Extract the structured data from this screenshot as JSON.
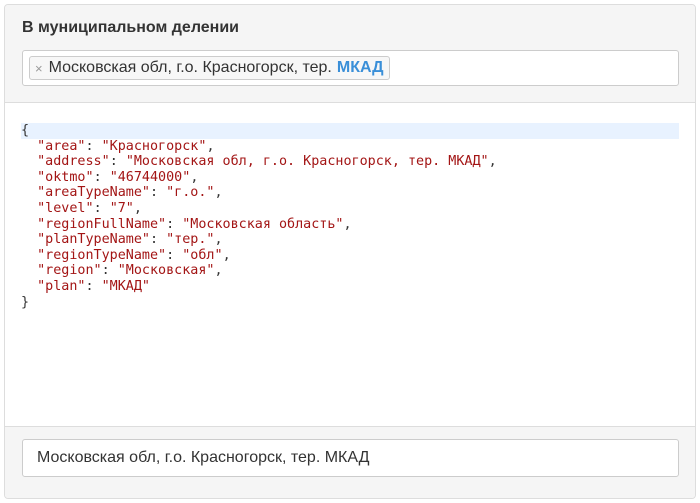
{
  "header": {
    "title": "В муниципальном делении",
    "token": {
      "remove_glyph": "×",
      "text": "Московская обл, г.о. Красногорск, тер.",
      "highlight": "МКАД",
      "highlight_color": "#3a8fd8"
    }
  },
  "json_view": {
    "open": "{",
    "close": "}",
    "entries": [
      {
        "key": "area",
        "value": "Красногорск"
      },
      {
        "key": "address",
        "value": "Московская обл, г.о. Красногорск, тер. МКАД"
      },
      {
        "key": "oktmo",
        "value": "46744000"
      },
      {
        "key": "areaTypeName",
        "value": "г.о."
      },
      {
        "key": "level",
        "value": "7"
      },
      {
        "key": "regionFullName",
        "value": "Московская область"
      },
      {
        "key": "planTypeName",
        "value": "тер."
      },
      {
        "key": "regionTypeName",
        "value": "обл"
      },
      {
        "key": "region",
        "value": "Московская"
      },
      {
        "key": "plan",
        "value": "МКАД"
      }
    ]
  },
  "footer": {
    "result_value": "Московская обл, г.о. Красногорск, тер. МКАД"
  },
  "colors": {
    "json_string": "#a31515",
    "active_line": "#e8f2ff"
  }
}
